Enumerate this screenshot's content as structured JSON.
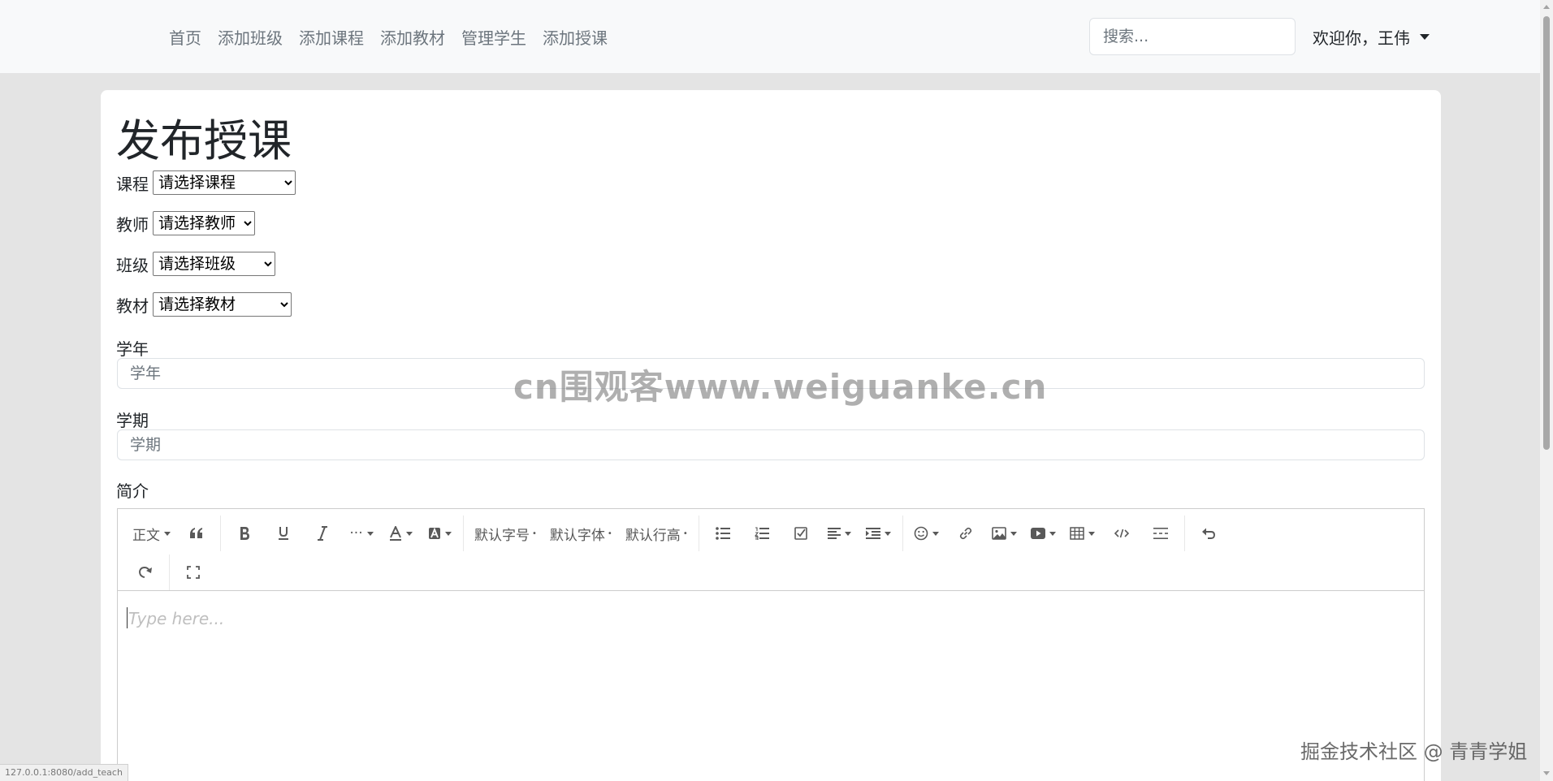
{
  "nav": {
    "links": [
      "首页",
      "添加班级",
      "添加课程",
      "添加教材",
      "管理学生",
      "添加授课"
    ],
    "search_placeholder": "搜索...",
    "user_greeting": "欢迎你，王伟"
  },
  "form": {
    "title": "发布授课",
    "course": {
      "label": "课程",
      "selected": "请选择课程"
    },
    "teacher": {
      "label": "教师",
      "selected": "请选择教师"
    },
    "class": {
      "label": "班级",
      "selected": "请选择班级"
    },
    "textbook": {
      "label": "教材",
      "selected": "请选择教材"
    },
    "year": {
      "label": "学年",
      "placeholder": "学年"
    },
    "term": {
      "label": "学期",
      "placeholder": "学期"
    },
    "intro": {
      "label": "简介"
    }
  },
  "editor": {
    "toolbar": {
      "paragraph": "正文",
      "font_size": "默认字号",
      "font_family": "默认字体",
      "line_height": "默认行高",
      "more": "···"
    },
    "placeholder": "Type here..."
  },
  "watermark": {
    "center": "cn围观客www.weiguanke.cn",
    "corner": "掘金技术社区 @ 青青学姐"
  },
  "status_url": "127.0.0.1:8080/add_teach"
}
